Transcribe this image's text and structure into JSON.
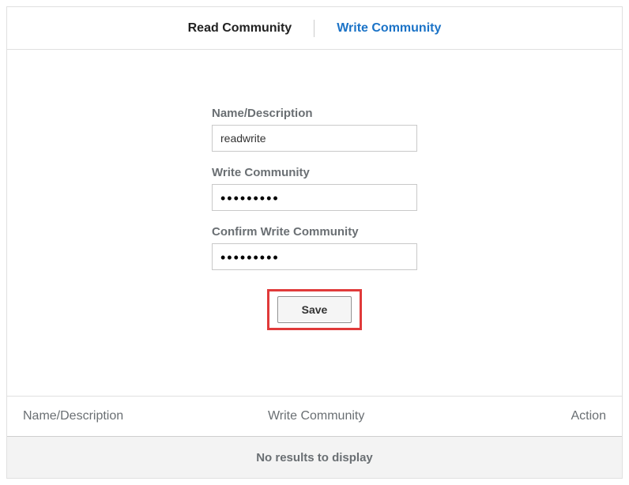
{
  "tabs": {
    "read_label": "Read Community",
    "write_label": "Write Community"
  },
  "form": {
    "name_label": "Name/Description",
    "name_value": "readwrite",
    "write_label": "Write Community",
    "write_value": "•••••••••",
    "confirm_label": "Confirm Write Community",
    "confirm_value": "•••••••••",
    "save_label": "Save"
  },
  "table": {
    "col_name": "Name/Description",
    "col_community": "Write Community",
    "col_action": "Action",
    "empty_message": "No results to display",
    "rows": []
  }
}
